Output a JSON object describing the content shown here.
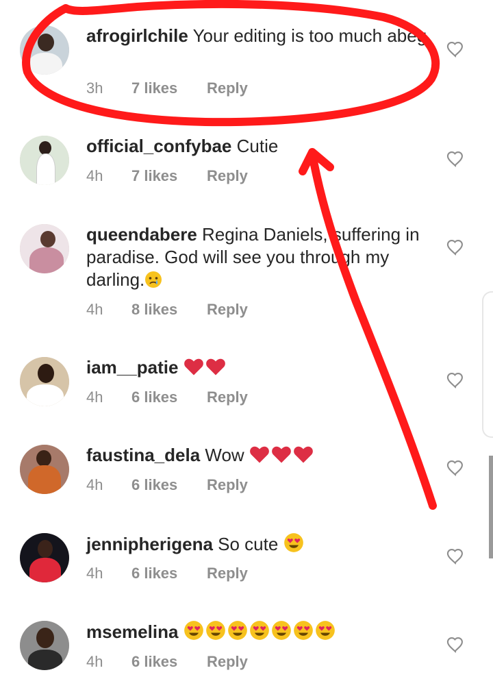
{
  "comments": [
    {
      "user": "afrogirlchile",
      "text": " Your editing is too much abeg",
      "time": "3h",
      "likes": "7 likes",
      "reply": "Reply",
      "avatar": "#7b8fa0"
    },
    {
      "user": "official_confybae",
      "text": " Cutie",
      "time": "4h",
      "likes": "7 likes",
      "reply": "Reply",
      "avatar": "#dfe8d6"
    },
    {
      "user": "queendabere",
      "text": " Regina Daniels, suffering in paradise. God will see you through my darling.",
      "time": "4h",
      "likes": "8 likes",
      "reply": "Reply",
      "avatar": "#e8dde2",
      "emoji": "crying-face"
    },
    {
      "user": "iam__patie",
      "text": " ",
      "time": "4h",
      "likes": "6 likes",
      "reply": "Reply",
      "avatar": "#d7c3a5",
      "emoji": "red-heart",
      "emoji_count": 2
    },
    {
      "user": "faustina_dela",
      "text": " Wow ",
      "time": "4h",
      "likes": "6 likes",
      "reply": "Reply",
      "avatar": "#b77b64",
      "emoji": "red-heart",
      "emoji_count": 3
    },
    {
      "user": "jennipherigena",
      "text": " So cute ",
      "time": "4h",
      "likes": "6 likes",
      "reply": "Reply",
      "avatar": "#1d1d26",
      "emoji": "heart-eyes",
      "emoji_count": 1
    },
    {
      "user": "msemelina",
      "text": " ",
      "time": "4h",
      "likes": "6 likes",
      "reply": "Reply",
      "avatar": "#8a8a8a",
      "emoji": "heart-eyes",
      "emoji_count": 7
    }
  ],
  "colors": {
    "annotation": "#ff1a1a",
    "meta": "#8e8e8e",
    "heart_icon": "#8e8e8e"
  }
}
